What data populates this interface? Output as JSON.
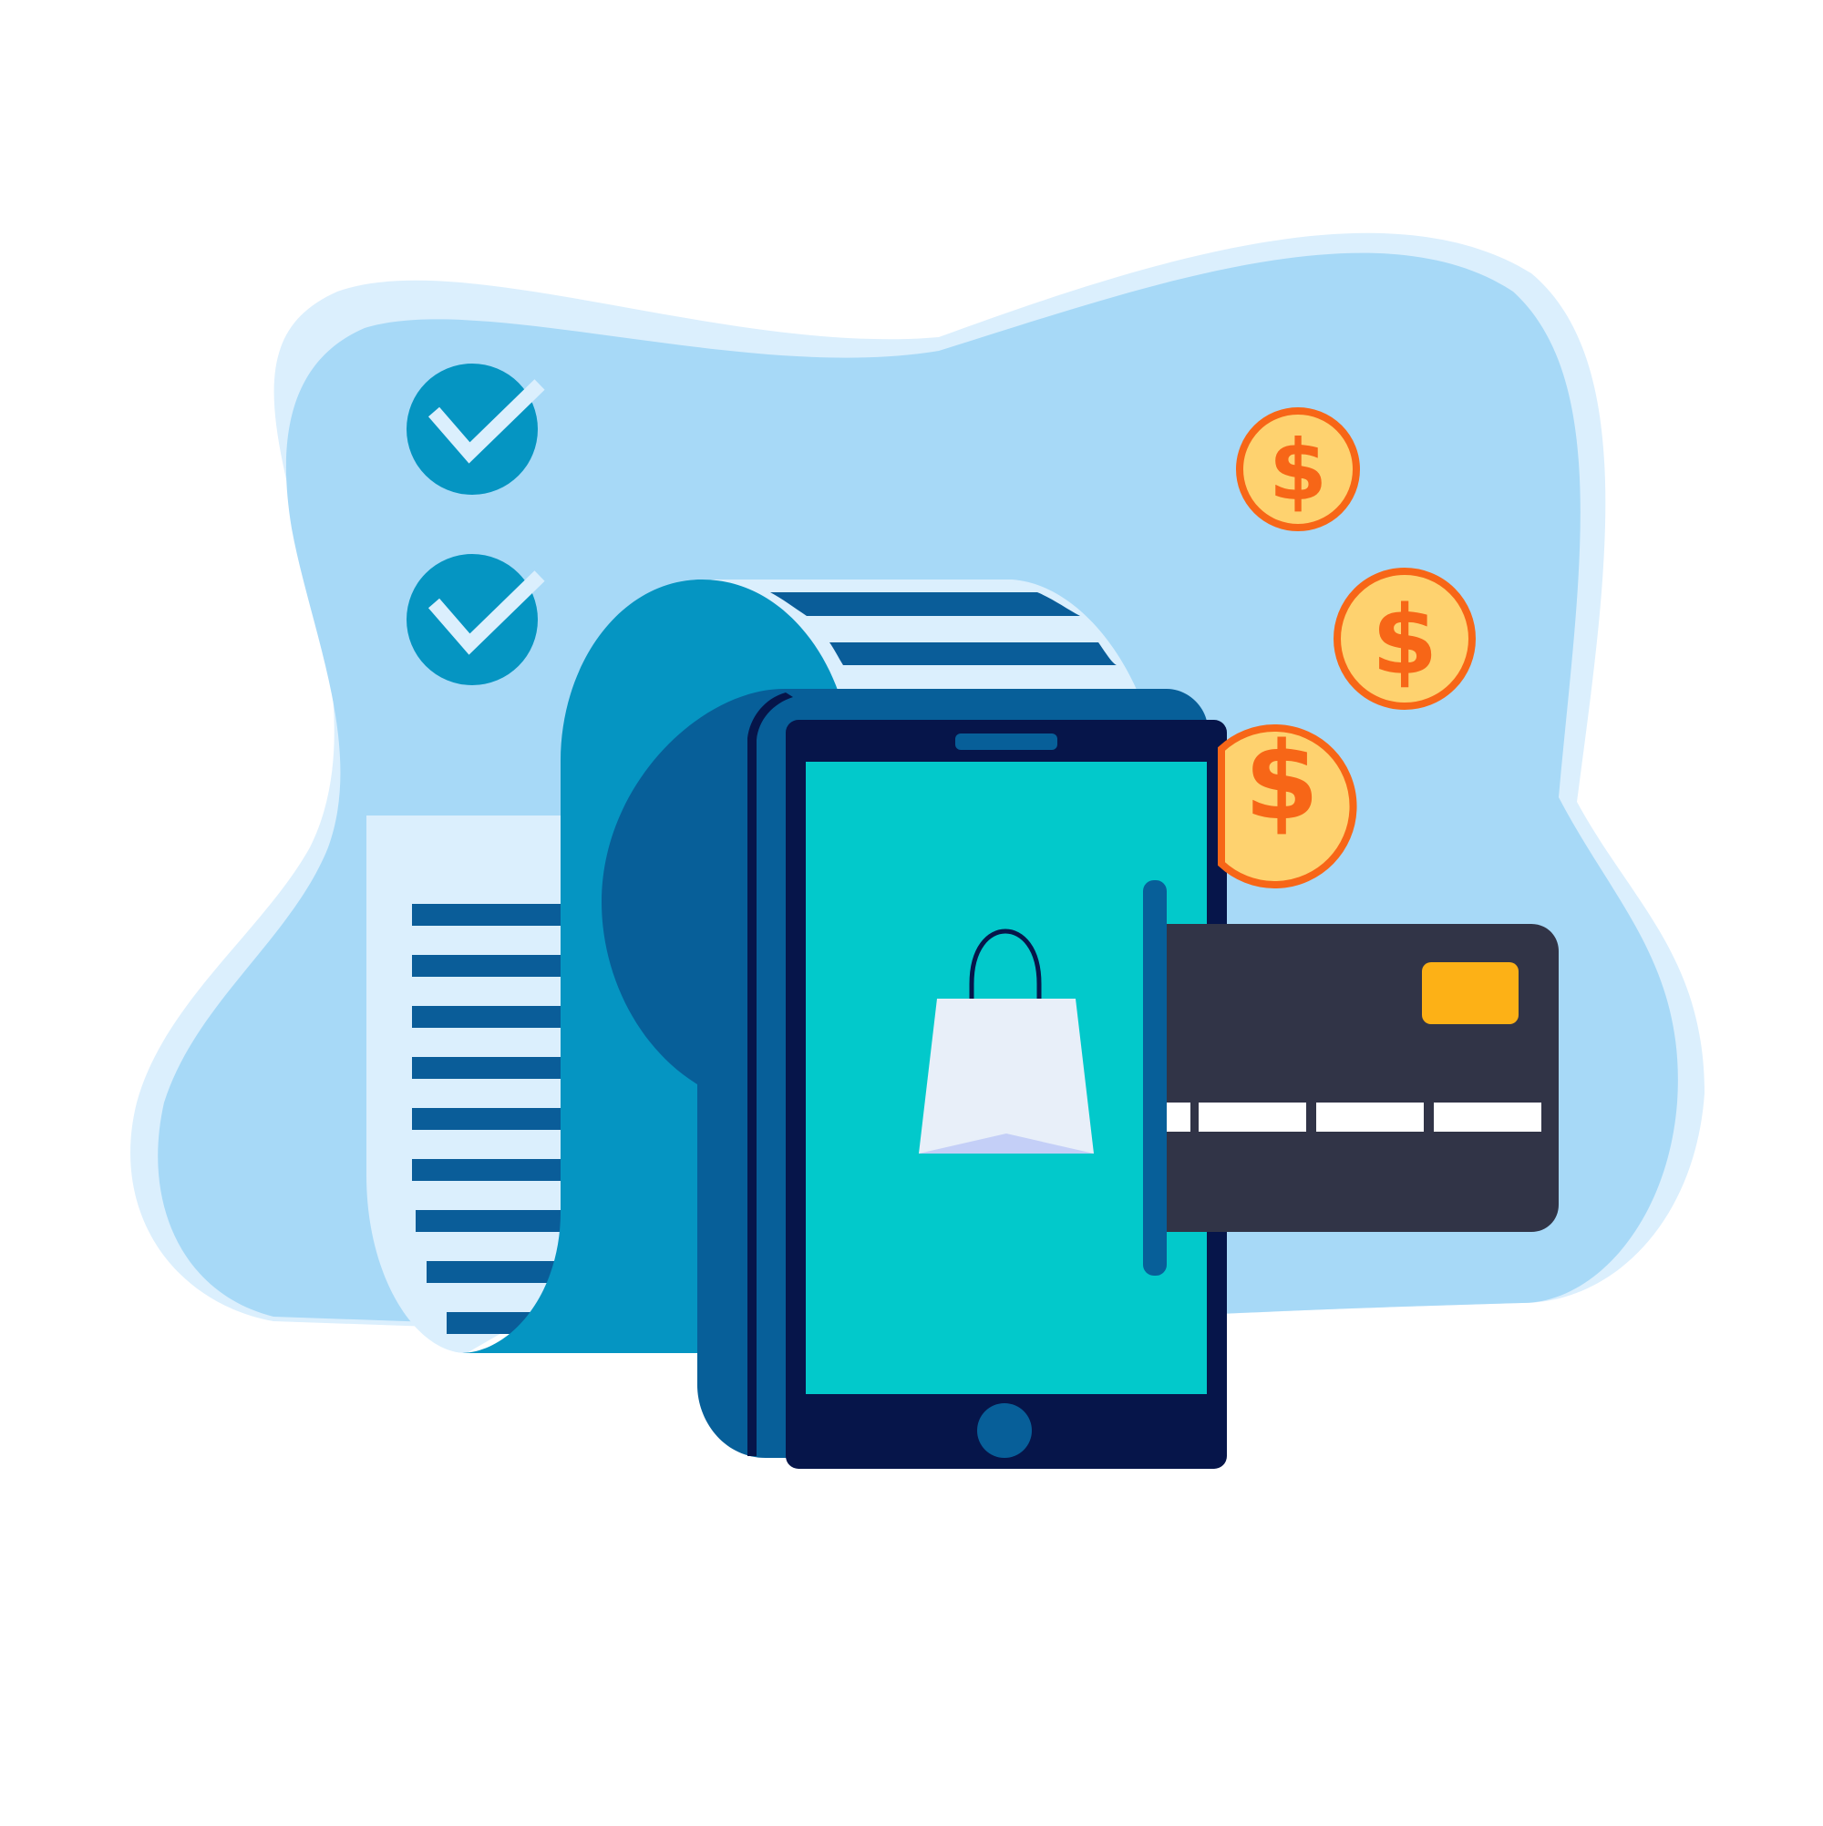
{
  "illustration": {
    "coin_symbol": "$",
    "icons": [
      "check-circle-icon",
      "check-circle-icon",
      "receipt-roll-icon",
      "tablet-icon",
      "shopping-bag-icon",
      "credit-card-icon",
      "dollar-coin-icon"
    ]
  },
  "colors": {
    "blob_outer": "#dbeffd",
    "blob_inner": "#a7d9f7",
    "receipt_paper": "#dbeffd",
    "receipt_lines": "#0a5d99",
    "receipt_roll": "#0595c2",
    "tablet_back": "#075f99",
    "tablet_frame": "#06154a",
    "tablet_screen": "#02c9cb",
    "bag": "#e8eff9",
    "bag_shadow": "#c4cff7",
    "card_body": "#313447",
    "card_chip": "#fdb116",
    "card_stripe": "#ffffff",
    "coin_fill": "#fed26f",
    "coin_edge": "#f76617",
    "check_circle": "#0595c2",
    "check_mark": "#dbeffd"
  }
}
